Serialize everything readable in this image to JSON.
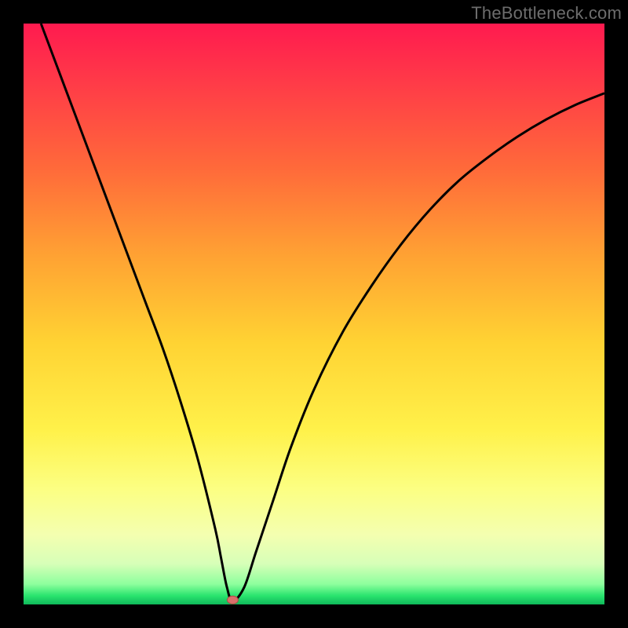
{
  "watermark": "TheBottleneck.com",
  "colors": {
    "black": "#000000",
    "curve": "#000000",
    "marker_fill": "#d9706b",
    "marker_stroke": "#b24a44",
    "gradient_stops": [
      {
        "offset": 0.0,
        "color": "#ff1a4f"
      },
      {
        "offset": 0.1,
        "color": "#ff3a48"
      },
      {
        "offset": 0.25,
        "color": "#ff6a3a"
      },
      {
        "offset": 0.4,
        "color": "#ffa233"
      },
      {
        "offset": 0.55,
        "color": "#ffd333"
      },
      {
        "offset": 0.7,
        "color": "#fff14a"
      },
      {
        "offset": 0.8,
        "color": "#fcff82"
      },
      {
        "offset": 0.88,
        "color": "#f4ffb0"
      },
      {
        "offset": 0.93,
        "color": "#d7ffb8"
      },
      {
        "offset": 0.965,
        "color": "#8dff9d"
      },
      {
        "offset": 0.985,
        "color": "#29e46e"
      },
      {
        "offset": 1.0,
        "color": "#0fb95a"
      }
    ]
  },
  "chart_data": {
    "type": "line",
    "title": "",
    "xlabel": "",
    "ylabel": "",
    "xlim": [
      0,
      100
    ],
    "ylim": [
      0,
      100
    ],
    "grid": false,
    "legend": false,
    "series": [
      {
        "name": "bottleneck-curve",
        "x": [
          3,
          6,
          9,
          12,
          15,
          18,
          21,
          24,
          27,
          30,
          33,
          34,
          35,
          36,
          38,
          40,
          43,
          46,
          50,
          55,
          60,
          65,
          70,
          75,
          80,
          85,
          90,
          95,
          100
        ],
        "y": [
          100,
          92,
          84,
          76,
          68,
          60,
          52,
          44,
          35,
          25,
          13,
          8,
          3,
          0.5,
          3,
          9,
          18,
          27,
          37,
          47,
          55,
          62,
          68,
          73,
          77,
          80.5,
          83.5,
          86,
          88
        ]
      }
    ],
    "annotations": [
      {
        "name": "minimum-marker",
        "x": 36,
        "y": 0.5
      }
    ]
  }
}
